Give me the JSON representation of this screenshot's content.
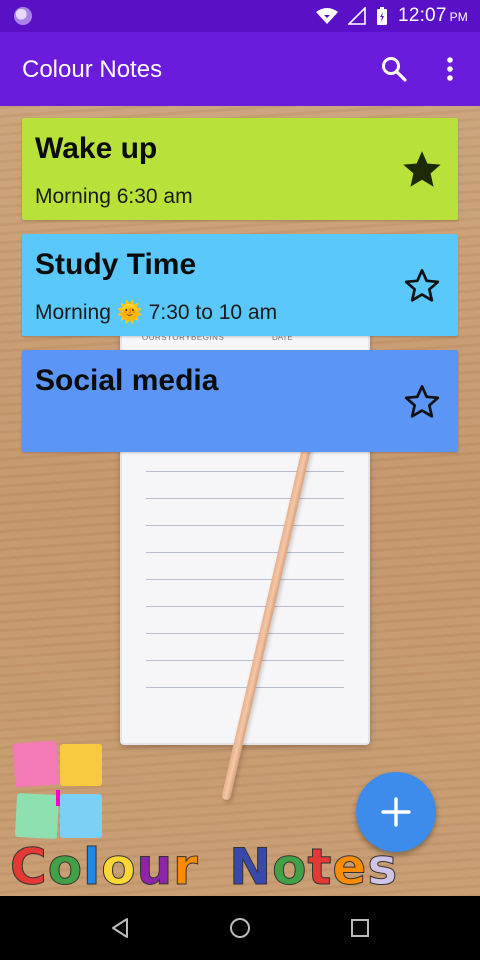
{
  "status_bar": {
    "time": "12:07",
    "ampm": "PM"
  },
  "app_bar": {
    "title": "Colour Notes",
    "search_icon": "search-icon",
    "menu_icon": "more-vert-icon"
  },
  "notes": [
    {
      "title": "Wake up",
      "subtitle": "Morning 6:30 am",
      "color": "#b8e239",
      "starred": true
    },
    {
      "title": "Study Time",
      "subtitle": "Morning 🌞 7:30 to 10 am",
      "color": "#5ac8fa",
      "starred": false
    },
    {
      "title": "Social media",
      "subtitle": "",
      "color": "#5b95f5",
      "starred": false
    }
  ],
  "background": {
    "notepad_header_left": "OURSTORYBEGINS",
    "notepad_header_right": "DATE"
  },
  "logo": {
    "text": "Colour Notes"
  },
  "fab": {
    "icon": "plus-icon",
    "color": "#3d8bea"
  },
  "nav_bar": {
    "back_icon": "back-icon",
    "home_icon": "home-icon",
    "recents_icon": "recents-icon"
  },
  "colors": {
    "status_bar": "#5a10c7",
    "app_bar": "#6a1bdc"
  }
}
